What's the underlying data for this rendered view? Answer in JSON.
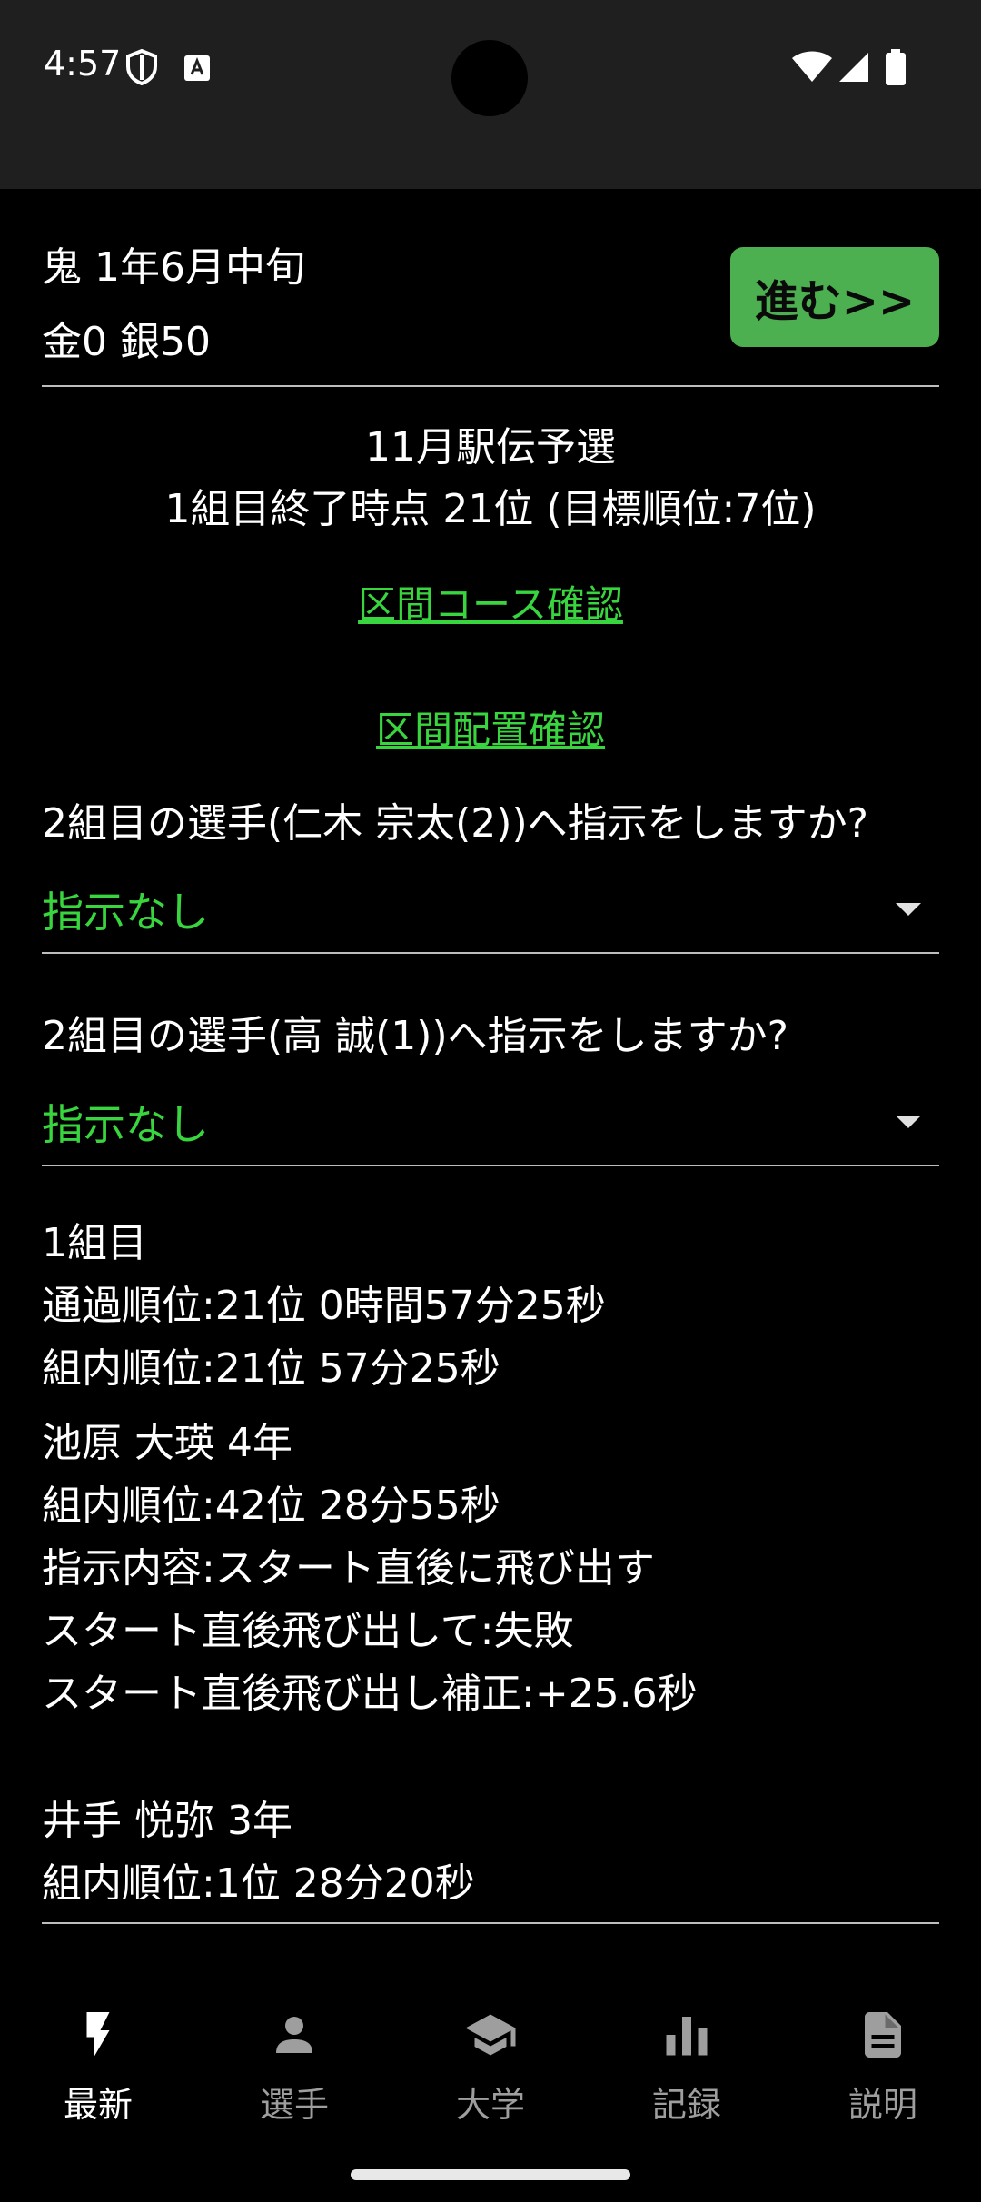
{
  "status_bar": {
    "time": "4:57"
  },
  "header": {
    "line1": "鬼  1年6月中旬",
    "line2": "金0 銀50",
    "advance_label": "進む>>"
  },
  "race": {
    "title": "11月駅伝予選",
    "status": "1組目終了時点 21位 (目標順位:7位)"
  },
  "links": {
    "course": "区間コース確認",
    "placement": "区間配置確認"
  },
  "instructions": [
    {
      "question": "2組目の選手(仁木 宗太(2))へ指示をしますか?",
      "value": "指示なし"
    },
    {
      "question": "2組目の選手(高 誠(1))へ指示をしますか?",
      "value": "指示なし"
    }
  ],
  "group_result": {
    "title": "1組目",
    "pass_rank": "通過順位:21位 0時間57分25秒",
    "group_rank": "組内順位:21位 57分25秒"
  },
  "runners": [
    {
      "name": "池原 大瑛 4年",
      "rank": "組内順位:42位 28分55秒",
      "instruction": "指示内容:スタート直後に飛び出す",
      "outcome": "スタート直後飛び出して:失敗",
      "correction": "スタート直後飛び出し補正:+25.6秒"
    },
    {
      "name": "井手 悦弥 3年",
      "rank": "組内順位:1位 28分20秒"
    }
  ],
  "nav": {
    "items": [
      {
        "label": "最新",
        "icon": "bolt-icon",
        "active": true
      },
      {
        "label": "選手",
        "icon": "person-icon",
        "active": false
      },
      {
        "label": "大学",
        "icon": "graduation-cap-icon",
        "active": false
      },
      {
        "label": "記録",
        "icon": "bar-chart-icon",
        "active": false
      },
      {
        "label": "説明",
        "icon": "document-icon",
        "active": false
      }
    ]
  },
  "colors": {
    "accent_green": "#39d53f",
    "button_green": "#4caf50",
    "background": "#000000",
    "status_bar": "#1f1f1f"
  }
}
